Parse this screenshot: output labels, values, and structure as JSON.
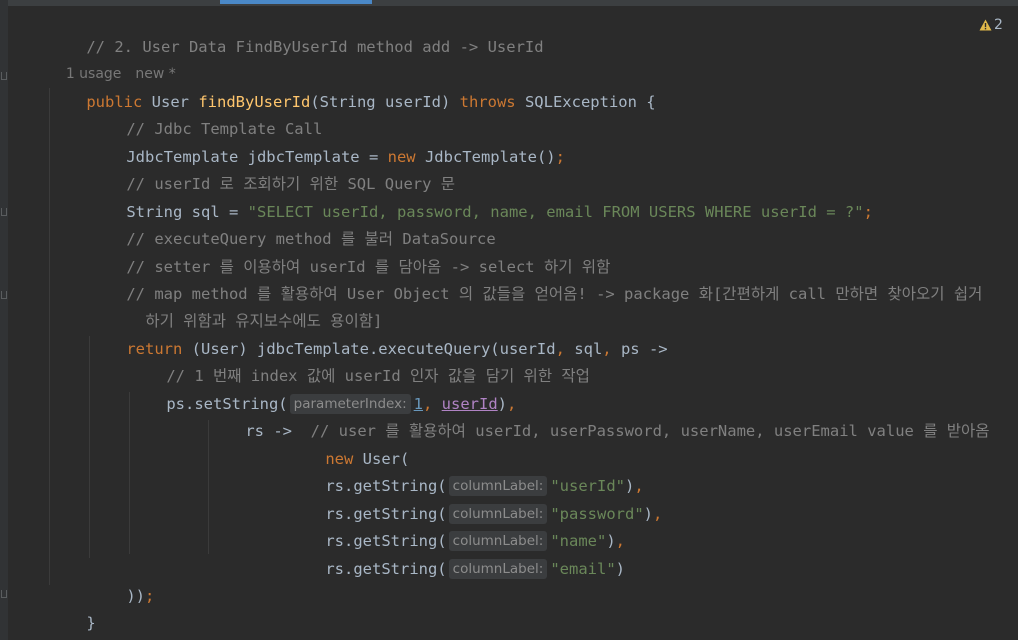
{
  "warning_badge": {
    "count": "2"
  },
  "code": {
    "line01": {
      "comment": "// 2. User Data FindByUserId method add -> UserId"
    },
    "meta": {
      "usages": "1 usage",
      "status": "new *"
    },
    "line02": {
      "kw_public": "public",
      "type_user": " User ",
      "method_name": "findByUserId",
      "params": "(String userId) ",
      "kw_throws": "throws",
      "exception": " SQLException {"
    },
    "line03": {
      "comment": "// Jdbc Template Call"
    },
    "line04": {
      "decl": "JdbcTemplate jdbcTemplate = ",
      "kw_new": "new",
      "ctor": " JdbcTemplate()",
      "semi": ";"
    },
    "line05": {
      "comment": "// userId 로 조회하기 위한 SQL Query 문"
    },
    "line06": {
      "decl": "String sql = ",
      "sql_string": "\"SELECT userId, password, name, email FROM USERS WHERE userId = ?\"",
      "semi": ";"
    },
    "line07": {
      "comment": "// executeQuery method 를 불러 DataSource"
    },
    "line08": {
      "comment": "// setter 를 이용하여 userId 를 담아옴 -> select 하기 위함"
    },
    "line09": {
      "comment": "// map method 를 활용하여 User Object 의 값들을 얻어옴! -> package 화[간편하게 call 만하면 찾아오기 쉽거"
    },
    "line10": {
      "comment": "하기 위함과 유지보수에도 용이함]"
    },
    "line11": {
      "kw_return": "return",
      "cast": " (User) jdbcTemplate.executeQuery(userId",
      "comma1": ",",
      "sql_arg": " sql",
      "comma2": ",",
      "lambda": " ps ->"
    },
    "line12": {
      "comment": "// 1 번째 index 값에 userId 인자 값을 담기 위한 작업"
    },
    "line13": {
      "call": "ps.setString(",
      "hint": "parameterIndex:",
      "index_value": "1",
      "comma": ",",
      "user_id_param": "userId",
      "close": ")",
      "trail": ","
    },
    "line14": {
      "lambda": "rs ->  ",
      "comment": "// user 를 활용하여 userId, userPassword, userName, userEmail value 를 받아옴"
    },
    "line15": {
      "kw_new": "new",
      "ctor": " User("
    },
    "getters": [
      {
        "call": "rs.getString(",
        "hint": "columnLabel:",
        "value": "\"userId\"",
        "close": ")",
        "trail": ","
      },
      {
        "call": "rs.getString(",
        "hint": "columnLabel:",
        "value": "\"password\"",
        "close": ")",
        "trail": ","
      },
      {
        "call": "rs.getString(",
        "hint": "columnLabel:",
        "value": "\"name\"",
        "close": ")",
        "trail": ","
      },
      {
        "call": "rs.getString(",
        "hint": "columnLabel:",
        "value": "\"email\"",
        "close": ")",
        "trail": ""
      }
    ],
    "line20": {
      "close": "))",
      "semi": ";"
    },
    "line21": {
      "brace": "}"
    },
    "line22": {
      "brace": "}"
    }
  },
  "colors": {
    "background": "#2b2b2b",
    "keyword": "#cc7832",
    "comment": "#808080",
    "string": "#6a8759",
    "method": "#ffc66d",
    "number": "#6897bb",
    "parameter": "#b083c4",
    "warning": "#e0b84a"
  }
}
